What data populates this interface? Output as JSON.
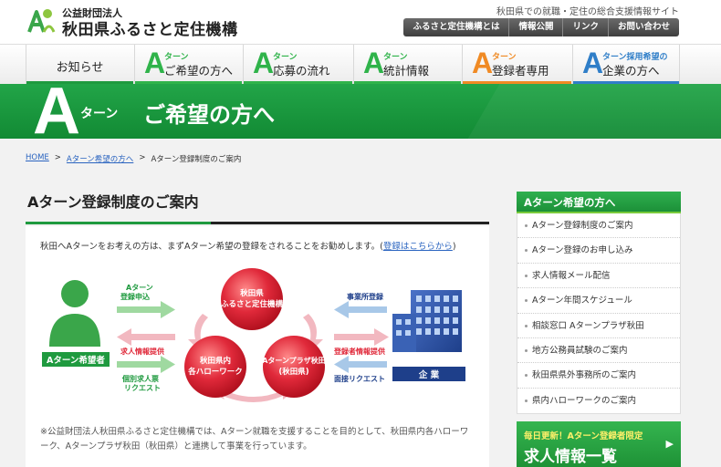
{
  "header": {
    "org_sub": "公益財団法人",
    "org_name": "秋田県ふるさと定住機構",
    "tagline": "秋田県での就職・定住の総合支援情報サイト",
    "util_nav": [
      "ふるさと定住機構とは",
      "情報公開",
      "リンク",
      "お問い合わせ"
    ]
  },
  "gnav": [
    {
      "label": "お知らせ",
      "letter": "",
      "sup": "",
      "color": "#1f9a3f"
    },
    {
      "label": "ご希望の方へ",
      "letter": "A",
      "sup": "ターン",
      "color": "#2fb34a"
    },
    {
      "label": "応募の流れ",
      "letter": "A",
      "sup": "ターン",
      "color": "#2fb34a"
    },
    {
      "label": "統計情報",
      "letter": "A",
      "sup": "ターン",
      "color": "#2fb34a"
    },
    {
      "label": "登録者専用",
      "letter": "A",
      "sup": "ターン",
      "color": "#f08a24"
    },
    {
      "label": "企業の方へ",
      "letter": "A",
      "sup": "ターン採用希望の",
      "color": "#2f7ec8"
    }
  ],
  "banner": {
    "letter": "A",
    "small": "ターン",
    "title": "ご希望の方へ"
  },
  "breadcrumb": {
    "home": "HOME",
    "parent": "Aターン希望の方へ",
    "current": "Aターン登録制度のご案内",
    "sep": ">"
  },
  "main": {
    "title": "Aターン登録制度のご案内",
    "intro": "秋田へAターンをお考えの方は、まずAターン希望の登録をされることをお勧めします。(",
    "intro_link": "登録はこちらから",
    "intro_end": ")",
    "note": "※公益財団法人秋田県ふるさと定住機構では、Aターン就職を支援することを目的として、秋田県内各ハローワーク、Aターンプラザ秋田（秋田県）と連携して事業を行っています。"
  },
  "diagram": {
    "person_label": "Aターン希望者",
    "company_label": "企 業",
    "circle_top": [
      "秋田県",
      "ふるさと定住機構"
    ],
    "circle_left": [
      "秋田県内",
      "各ハローワーク"
    ],
    "circle_right": [
      "Aターンプラザ秋田",
      "(秋田県)"
    ],
    "arrow_l1": [
      "Aターン",
      "登録申込"
    ],
    "arrow_l2": [
      "求人情報提供"
    ],
    "arrow_l3": [
      "個別求人票",
      "リクエスト"
    ],
    "arrow_r1": [
      "事業所登録"
    ],
    "arrow_r2": [
      "登録者情報提供"
    ],
    "arrow_r3": [
      "面接リクエスト"
    ]
  },
  "sidebar": {
    "heading": "Aターン希望の方へ",
    "items": [
      "Aターン登録制度のご案内",
      "Aターン登録のお申し込み",
      "求人情報メール配信",
      "Aターン年間スケジュール",
      "相談窓口 Aターンプラザ秋田",
      "地方公務員試験のご案内",
      "秋田県県外事務所のご案内",
      "県内ハローワークのご案内"
    ]
  },
  "promo": {
    "line1": "毎日更新！Aターン登録者限定",
    "line2": "求人情報一覧",
    "arrow": "▶"
  },
  "colors": {
    "green": "#1f9a3f",
    "red": "#e0293a",
    "pink_arrow": "#f2b8c0",
    "green_arrow": "#9fd9a0",
    "blue_arrow": "#a8c8e8",
    "navy": "#1e3f8a"
  }
}
